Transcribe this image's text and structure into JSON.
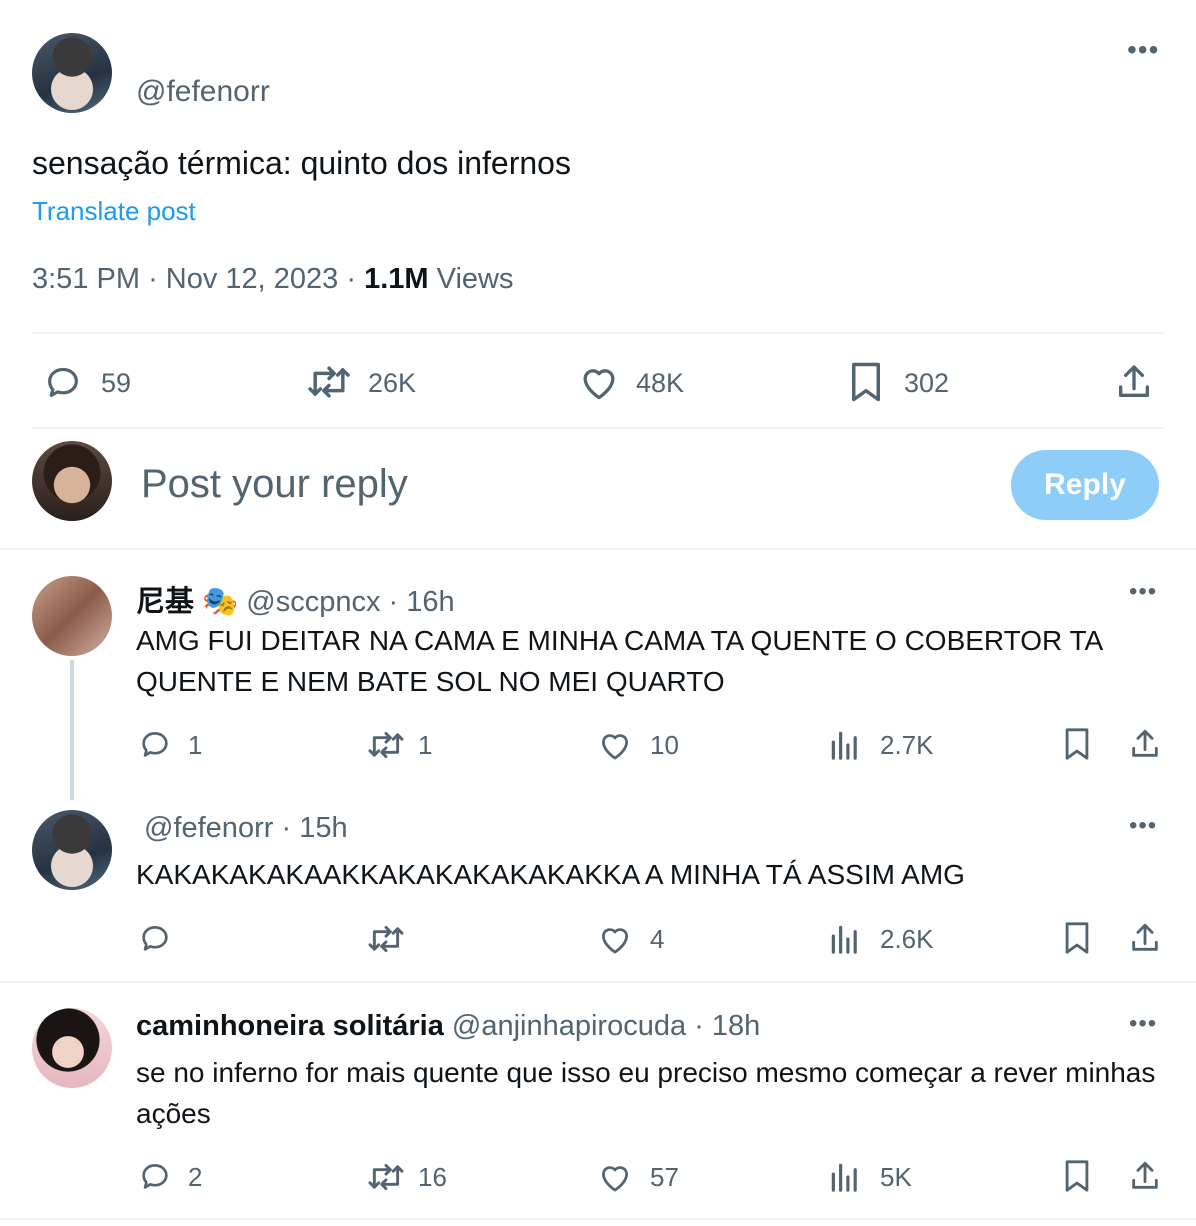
{
  "main_post": {
    "handle": "@fefenorr",
    "text": "sensação térmica: quinto dos infernos",
    "translate": "Translate post",
    "time": "3:51 PM",
    "date": "Nov 12, 2023",
    "views_count": "1.1M",
    "views_label": "Views",
    "stats": {
      "replies": "59",
      "reposts": "26K",
      "likes": "48K",
      "bookmarks": "302"
    }
  },
  "reply_box": {
    "placeholder": "Post your reply",
    "button": "Reply"
  },
  "replies": [
    {
      "name": "尼基",
      "emoji": "🎭",
      "handle": "@sccpncx",
      "time": "16h",
      "text": "AMG FUI DEITAR NA CAMA E MINHA CAMA TA QUENTE O COBERTOR TA QUENTE E NEM BATE SOL NO MEI QUARTO",
      "replies": "1",
      "reposts": "1",
      "likes": "10",
      "views": "2.7K"
    },
    {
      "handle": "@fefenorr",
      "time": "15h",
      "text": "KAKAKAKAKAAKKAKAKAKAKAKAKKA A MINHA TÁ ASSIM AMG",
      "replies": "",
      "reposts": "",
      "likes": "4",
      "views": "2.6K"
    },
    {
      "name": "caminhoneira solitária",
      "handle": "@anjinhapirocuda",
      "time": "18h",
      "text": "se no inferno for mais quente que isso eu preciso mesmo começar a rever minhas ações",
      "replies": "2",
      "reposts": "16",
      "likes": "57",
      "views": "5K"
    }
  ],
  "icons": [
    "more-icon",
    "reply-icon",
    "repost-icon",
    "like-icon",
    "bookmark-icon",
    "share-icon",
    "views-icon"
  ],
  "colors": {
    "accent": "#1d9bf0",
    "reply_button": "#8ecdf7",
    "muted": "#536471",
    "text": "#0f1419",
    "divider": "#eff3f4"
  }
}
